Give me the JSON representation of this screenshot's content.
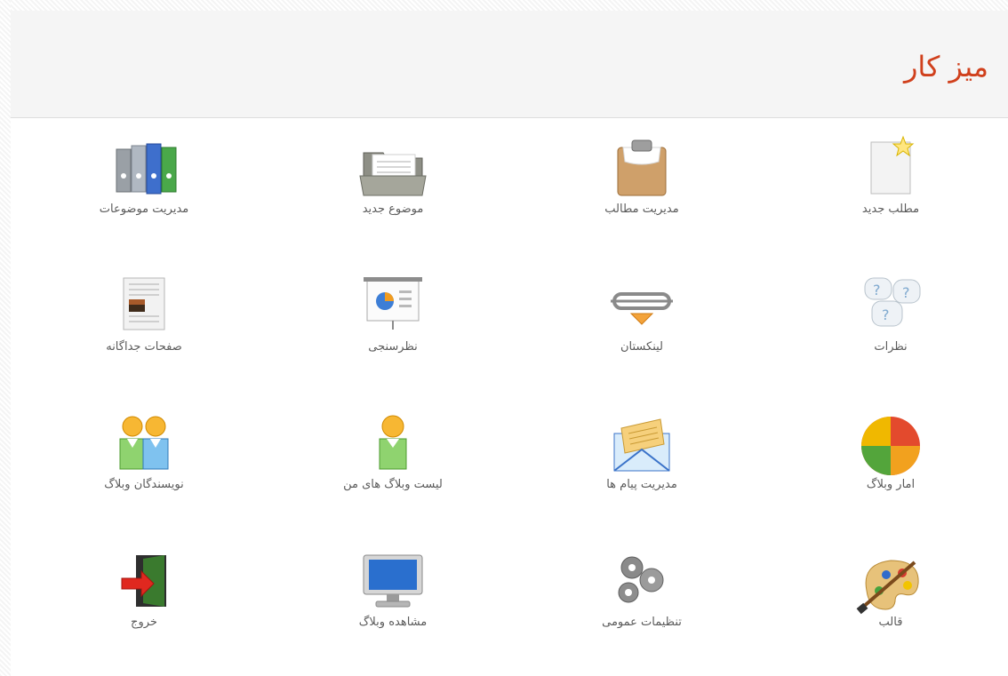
{
  "page": {
    "title": "میز کار"
  },
  "tiles": [
    {
      "label": "مطلب جدید",
      "icon": "new-post-icon"
    },
    {
      "label": "مدیریت مطالب",
      "icon": "clipboard-icon"
    },
    {
      "label": "موضوع جدید",
      "icon": "folder-icon"
    },
    {
      "label": "مدیریت موضوعات",
      "icon": "binders-icon"
    },
    {
      "label": "نظرات",
      "icon": "question-bubbles-icon"
    },
    {
      "label": "لینکستان",
      "icon": "chain-link-icon"
    },
    {
      "label": "نظرسنجی",
      "icon": "presentation-chart-icon"
    },
    {
      "label": "صفحات جداگانه",
      "icon": "document-page-icon"
    },
    {
      "label": "امار وبلاگ",
      "icon": "pie-chart-icon"
    },
    {
      "label": "مدیریت پیام ها",
      "icon": "envelope-icon"
    },
    {
      "label": "لیست وبلاگ های من",
      "icon": "user-icon"
    },
    {
      "label": "نویسندگان وبلاگ",
      "icon": "users-icon"
    },
    {
      "label": "قالب",
      "icon": "palette-icon"
    },
    {
      "label": "تنظیمات عمومی",
      "icon": "gears-icon"
    },
    {
      "label": "مشاهده وبلاگ",
      "icon": "monitor-icon"
    },
    {
      "label": "خروج",
      "icon": "exit-door-icon"
    }
  ],
  "colors": {
    "title": "#d0401c",
    "label": "#5a5a5a",
    "header_bg": "#f5f5f5"
  }
}
